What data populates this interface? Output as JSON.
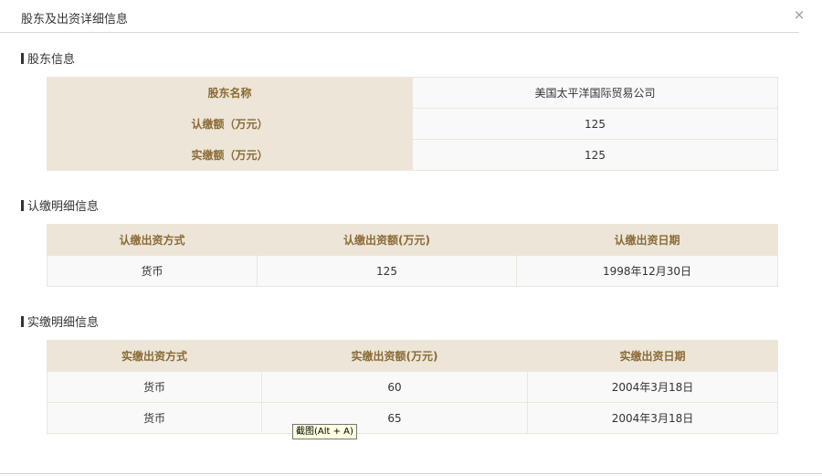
{
  "dialog": {
    "title": "股东及出资详细信息",
    "close_symbol": "×"
  },
  "shareholder": {
    "section_title": "股东信息",
    "rows": [
      {
        "label": "股东名称",
        "value": "美国太平洋国际贸易公司"
      },
      {
        "label": "认缴额（万元）",
        "value": "125"
      },
      {
        "label": "实缴额（万元）",
        "value": "125"
      }
    ]
  },
  "subscribed": {
    "section_title": "认缴明细信息",
    "headers": [
      "认缴出资方式",
      "认缴出资额(万元)",
      "认缴出资日期"
    ],
    "rows": [
      [
        "货币",
        "125",
        "1998年12月30日"
      ]
    ]
  },
  "paid": {
    "section_title": "实缴明细信息",
    "headers": [
      "实缴出资方式",
      "实缴出资额(万元)",
      "实缴出资日期"
    ],
    "rows": [
      [
        "货币",
        "60",
        "2004年3月18日"
      ],
      [
        "货币",
        "65",
        "2004年3月18日"
      ]
    ]
  },
  "tooltip": {
    "text": "截图(Alt + A)"
  },
  "colors": {
    "header_bg": "#ece5d8",
    "header_text": "#8b6a35",
    "cell_bg": "#f9f9f9"
  },
  "icons": {
    "close": "close-icon"
  }
}
